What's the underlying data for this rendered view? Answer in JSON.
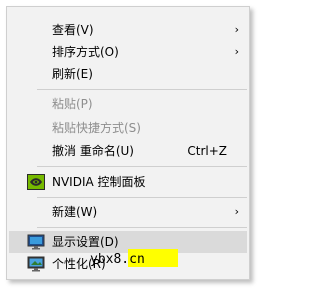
{
  "menu": {
    "items": [
      {
        "label": "查看(V)",
        "arrow": "›"
      },
      {
        "label": "排序方式(O)",
        "arrow": "›"
      },
      {
        "label": "刷新(E)"
      },
      {
        "label": "粘贴(P)"
      },
      {
        "label": "粘贴快捷方式(S)"
      },
      {
        "label": "撤消 重命名(U)",
        "shortcut": "Ctrl+Z"
      },
      {
        "label": "NVIDIA 控制面板"
      },
      {
        "label": "新建(W)",
        "arrow": "›"
      },
      {
        "label": "显示设置(D)"
      },
      {
        "label": "个性化(R)"
      }
    ]
  },
  "watermark": {
    "text": "ybx8.cn",
    "color": "#ffff00"
  },
  "colors": {
    "menu_bg": "#f2f2f2",
    "hover_bg": "#dadada",
    "disabled_text": "#8e8e8e",
    "nvidia_green": "#76b900"
  }
}
